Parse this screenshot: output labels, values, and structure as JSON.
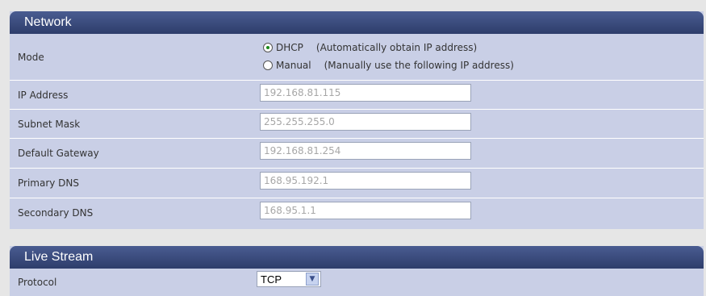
{
  "network": {
    "title": "Network",
    "mode": {
      "label": "Mode",
      "options": [
        {
          "value": "DHCP",
          "desc": "(Automatically obtain IP address)",
          "selected": true
        },
        {
          "value": "Manual",
          "desc": "(Manually use the following IP address)",
          "selected": false
        }
      ]
    },
    "fields": [
      {
        "label": "IP Address",
        "value": "192.168.81.115"
      },
      {
        "label": "Subnet Mask",
        "value": "255.255.255.0"
      },
      {
        "label": "Default Gateway",
        "value": "192.168.81.254"
      },
      {
        "label": "Primary DNS",
        "value": "168.95.192.1"
      },
      {
        "label": "Secondary DNS",
        "value": "168.95.1.1"
      }
    ]
  },
  "live_stream": {
    "title": "Live Stream",
    "protocol": {
      "label": "Protocol",
      "value": "TCP"
    }
  },
  "colors": {
    "header_bg": "#2e3d6b",
    "panel_bg": "#c9cfe6",
    "dhcp_radio": "#1a8a1a"
  }
}
